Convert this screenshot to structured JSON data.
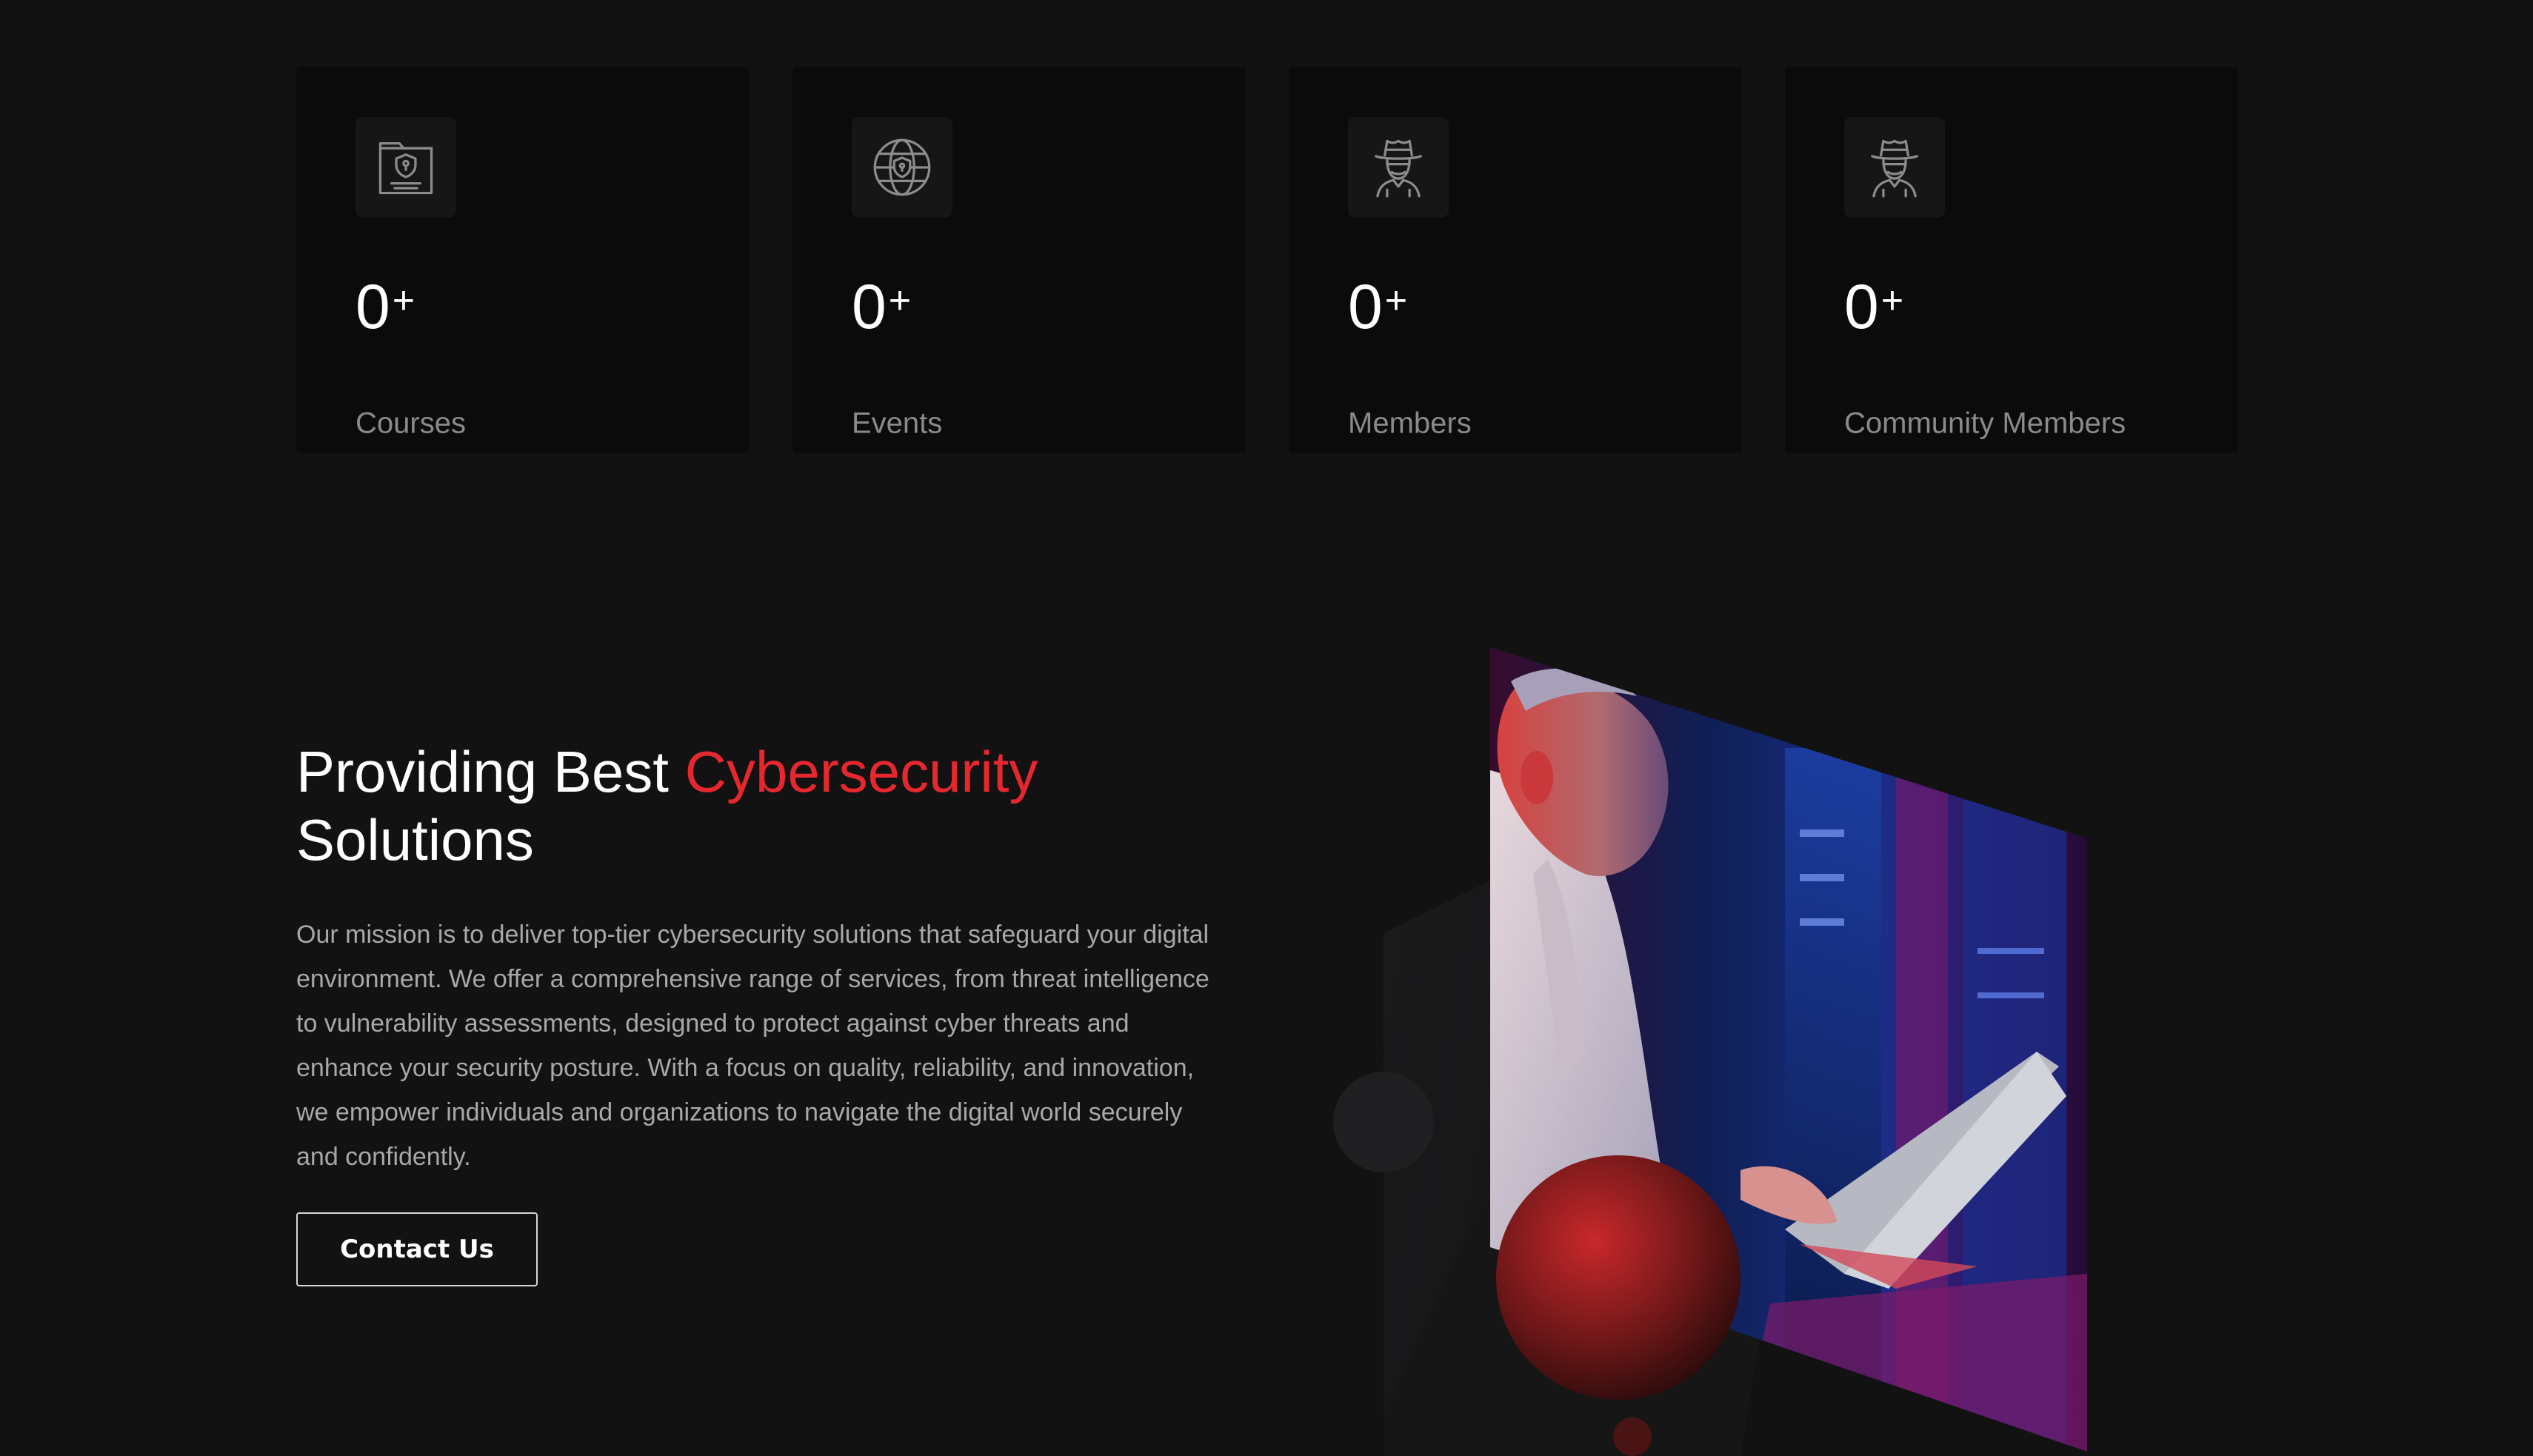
{
  "stats": [
    {
      "value": "0",
      "suffix": "+",
      "label": "Courses",
      "icon": "shield-document-icon"
    },
    {
      "value": "0",
      "suffix": "+",
      "label": "Events",
      "icon": "globe-shield-icon"
    },
    {
      "value": "0",
      "suffix": "+",
      "label": "Members",
      "icon": "hacker-icon"
    },
    {
      "value": "0",
      "suffix": "+",
      "label": "Community Members",
      "icon": "hacker-icon"
    }
  ],
  "about": {
    "heading_prefix": "Providing Best ",
    "heading_accent": "Cybersecurity",
    "heading_suffix": "Solutions",
    "description": "Our mission is to deliver top-tier cybersecurity solutions that safeguard your digital environment. We offer a comprehensive range of services, from threat intelligence to vulnerability assessments, designed to protect against cyber threats and enhance your security posture. With a focus on quality, reliability, and innovation, we empower individuals and organizations to navigate the digital world securely and confidently.",
    "button_label": "Contact Us"
  },
  "colors": {
    "background": "#121213",
    "card": "#0b0b0c",
    "accent": "#e6282e",
    "muted_text": "#8a8a8d"
  }
}
